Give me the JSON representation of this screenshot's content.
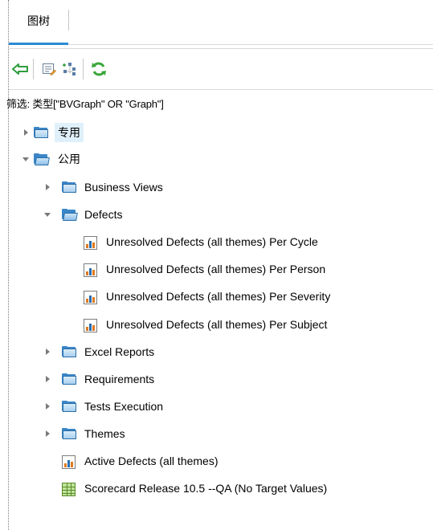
{
  "tabs": [
    {
      "label": "图树",
      "active": true
    }
  ],
  "toolbar": {
    "buttons": [
      {
        "name": "back",
        "icon": "back-arrow-icon"
      },
      {
        "name": "edit",
        "icon": "edit-list-icon"
      },
      {
        "name": "tree",
        "icon": "tree-structure-icon"
      },
      {
        "name": "refresh",
        "icon": "refresh-icon"
      }
    ]
  },
  "filter_text": "筛选: 类型[\"BVGraph\" OR \"Graph\"]",
  "tree": {
    "private_folder": {
      "label": "专用",
      "expanded": false,
      "selected": true
    },
    "public_folder": {
      "label": "公用",
      "expanded": true
    },
    "business_views": {
      "label": "Business Views",
      "expanded": false
    },
    "defects": {
      "label": "Defects",
      "expanded": true
    },
    "defects_children": [
      "Unresolved Defects (all themes) Per Cycle",
      "Unresolved Defects (all themes) Per Person",
      "Unresolved Defects (all themes) Per Severity",
      "Unresolved Defects (all themes) Per Subject"
    ],
    "excel_reports": {
      "label": "Excel Reports",
      "expanded": false
    },
    "requirements": {
      "label": "Requirements",
      "expanded": false
    },
    "tests_execution": {
      "label": "Tests Execution",
      "expanded": false
    },
    "themes": {
      "label": "Themes",
      "expanded": false
    },
    "active_defects": {
      "label": "Active Defects (all themes)"
    },
    "scorecard": {
      "label": "Scorecard Release 10.5 --QA (No Target Values)"
    }
  },
  "colors": {
    "tab_accent": "#2a8ad4",
    "selection": "#dff0fb",
    "folder": "#3a86c8",
    "back_arrow": "#2e9e3e",
    "refresh": "#3aa63a"
  }
}
